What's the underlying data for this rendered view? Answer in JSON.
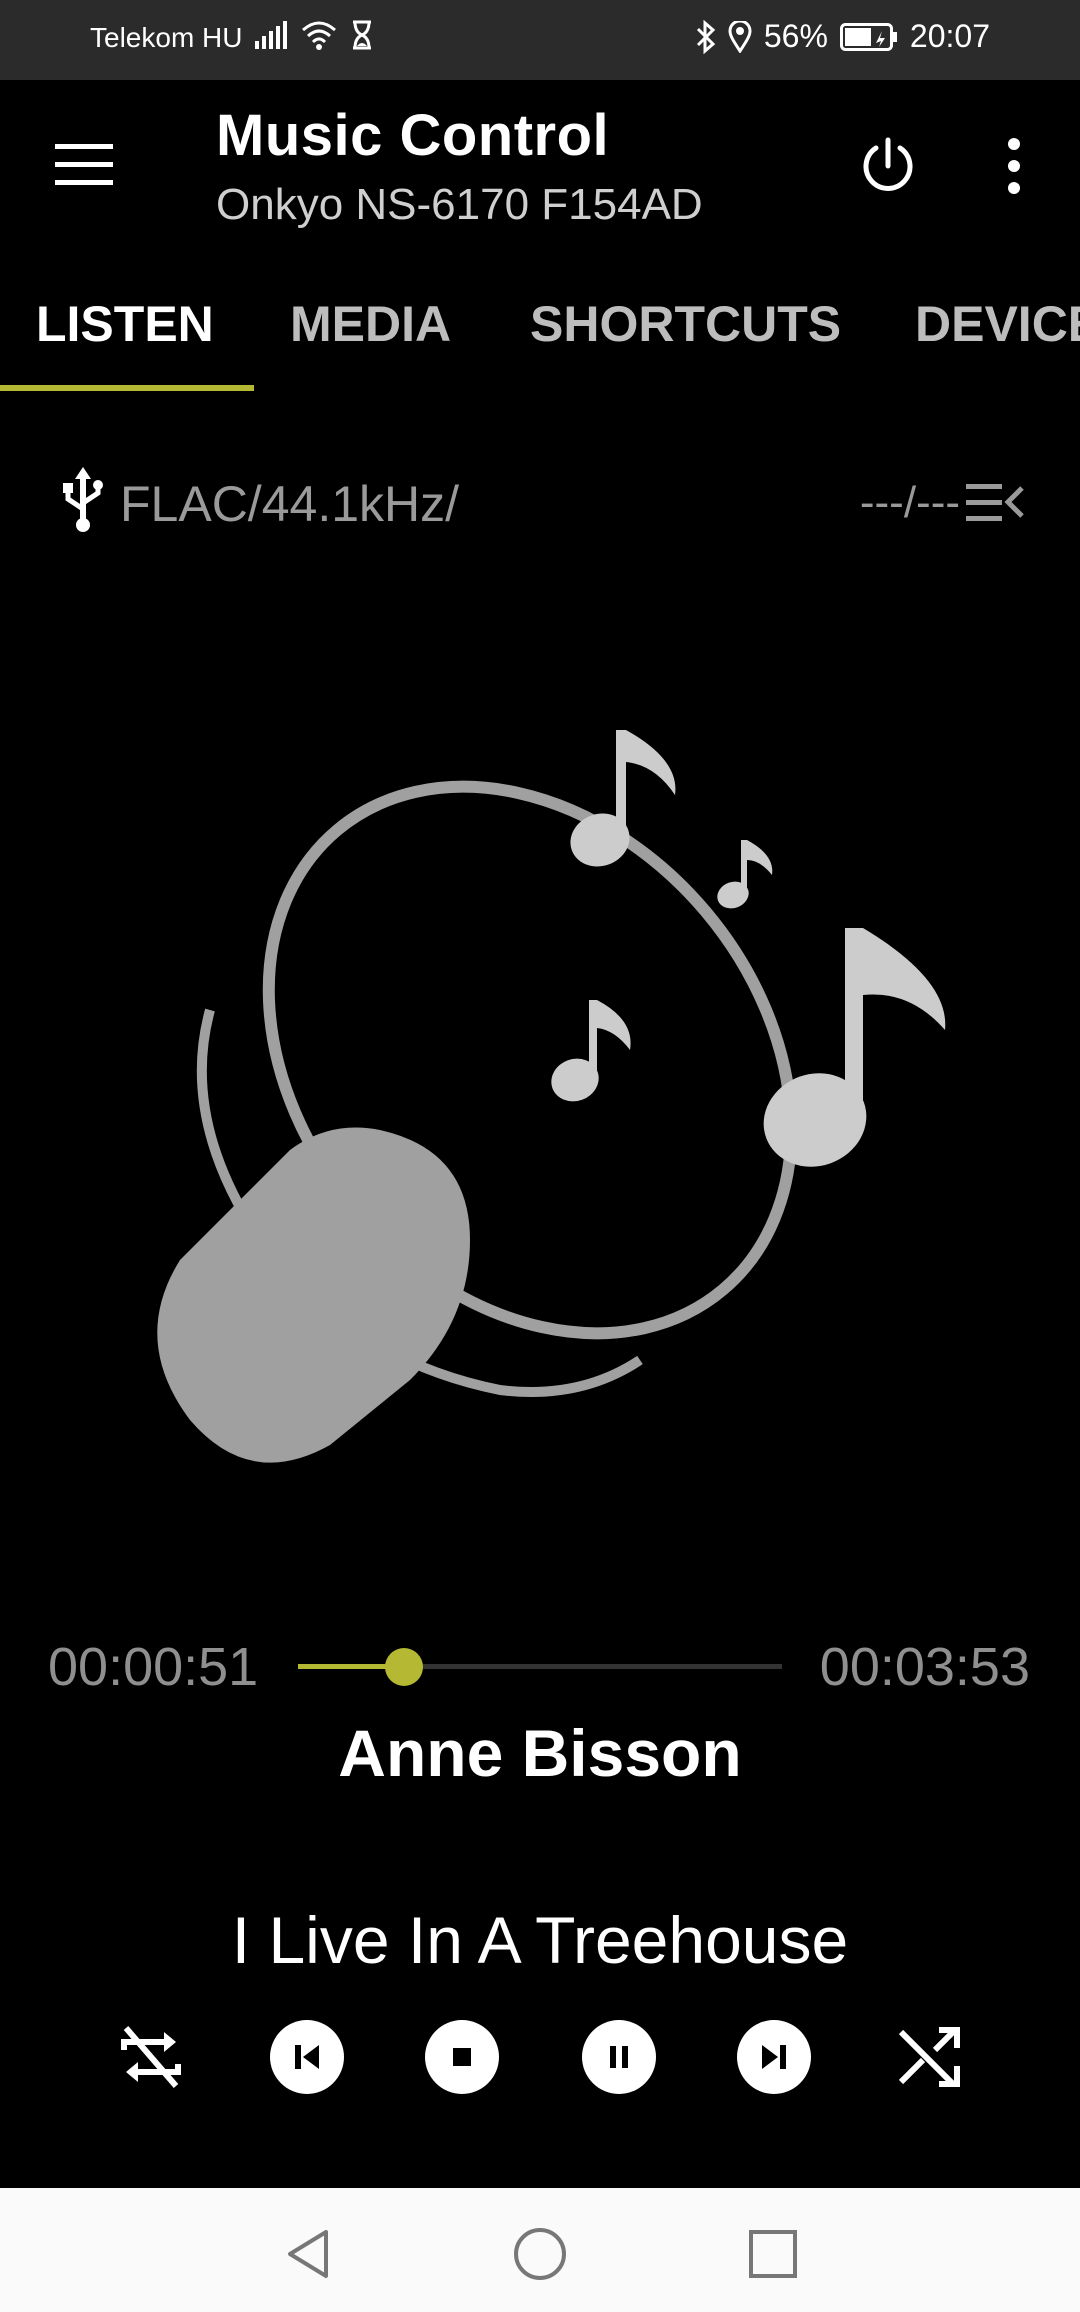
{
  "status_bar": {
    "carrier": "Telekom HU",
    "battery": "56%",
    "time": "20:07"
  },
  "app_bar": {
    "title": "Music Control",
    "subtitle": "Onkyo NS-6170 F154AD"
  },
  "tabs": [
    {
      "label": "LISTEN",
      "active": true
    },
    {
      "label": "MEDIA",
      "active": false
    },
    {
      "label": "SHORTCUTS",
      "active": false
    },
    {
      "label": "DEVICE",
      "active": false
    }
  ],
  "playback": {
    "format": "FLAC/44.1kHz/",
    "track_position": "---/---",
    "elapsed": "00:00:51",
    "total": "00:03:53",
    "progress": 0.219,
    "artist": "Anne Bisson",
    "song": "I Live In A Treehouse"
  },
  "colors": {
    "accent": "#b4b832",
    "background": "#000000",
    "status_bar": "#2b2b2b",
    "artwork_gray": "#a0a0a0",
    "note_gray": "#cccccc"
  },
  "icons": {
    "menu": "menu-icon",
    "power": "power-icon",
    "more": "more-vert-icon",
    "usb": "usb-icon",
    "queue": "queue-icon",
    "repeat": "repeat-off-icon",
    "previous": "skip-previous-icon",
    "stop": "stop-icon",
    "pause": "pause-icon",
    "next": "skip-next-icon",
    "shuffle": "shuffle-icon"
  }
}
